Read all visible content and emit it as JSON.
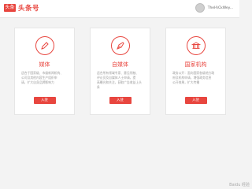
{
  "header": {
    "logo_badge": "头条",
    "logo_text": "头条号",
    "username": "TheH\\CkWey..."
  },
  "cards": [
    {
      "title": "媒体",
      "desc_lines": [
        "适合于国家级、市级新闻机构、",
        "公司及其他内容生产组织申",
        "请，扩大自身品牌影响力"
      ],
      "button": "入驻"
    },
    {
      "title": "自媒体",
      "desc_lines": [
        "适合所有领域专家、意见领袖、",
        "评论员及自媒体人士申请，提",
        "高曝光和关注，获取广告收益上头条"
      ],
      "button": "入驻"
    },
    {
      "title": "国家机构",
      "desc_lines": [
        "政务公开：面向国家各级地方政",
        "府及机构申请，增强政务信息",
        "公开效果，扩大传播"
      ],
      "button": "入驻"
    }
  ],
  "watermark": "Baidu 经验"
}
